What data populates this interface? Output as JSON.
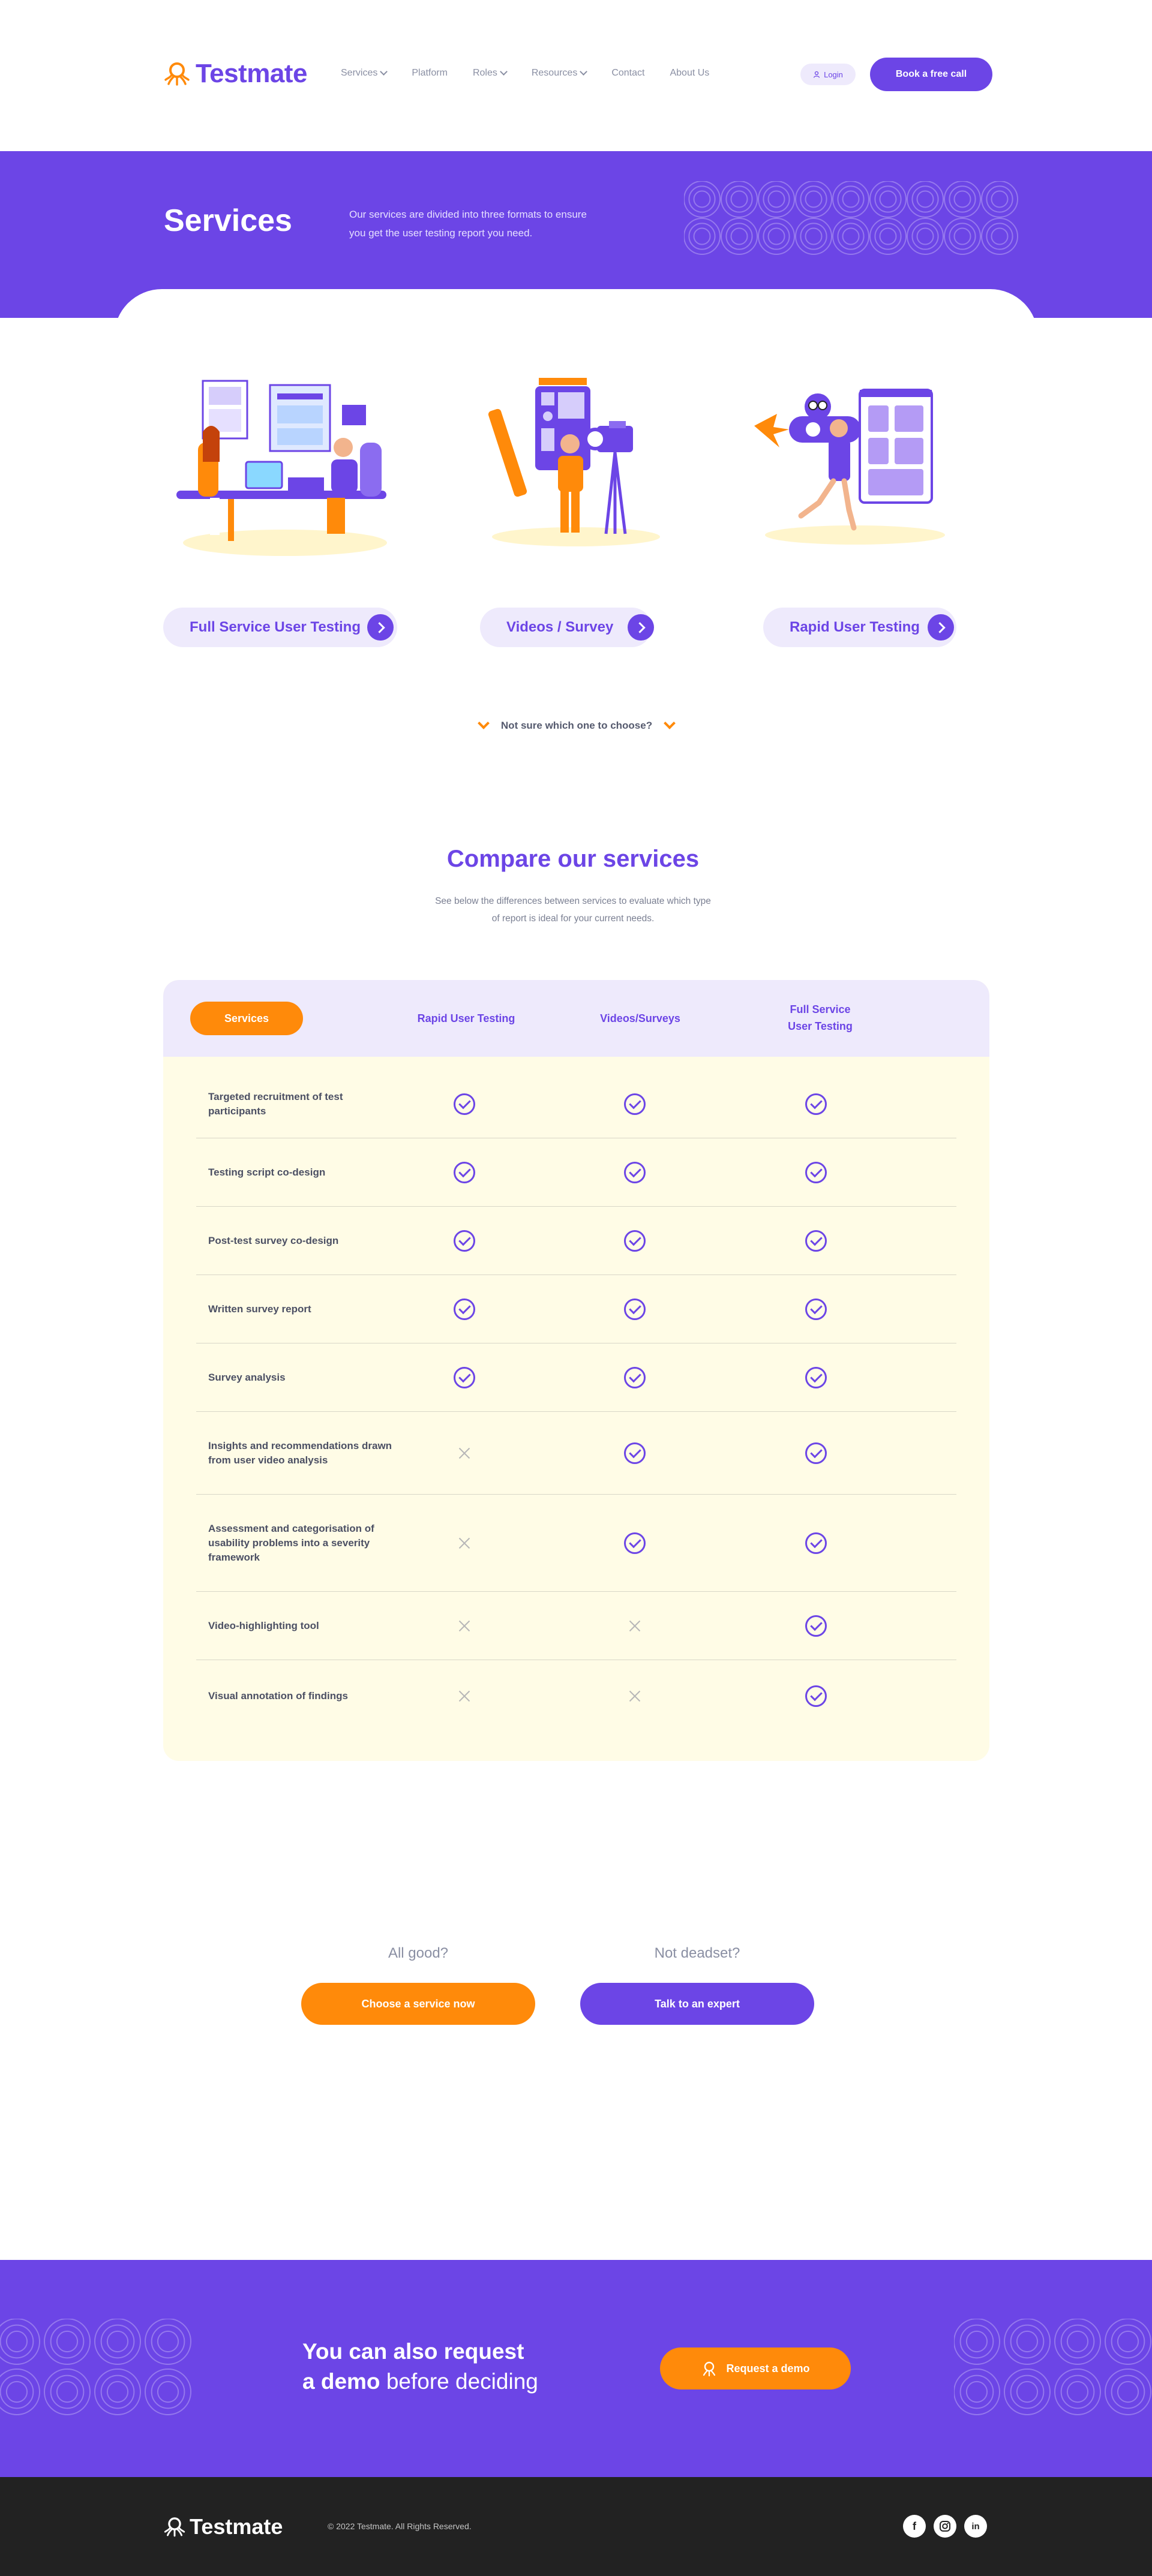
{
  "header": {
    "logo_text": "Testmate",
    "nav": [
      {
        "label": "Services",
        "dropdown": true
      },
      {
        "label": "Platform",
        "dropdown": false
      },
      {
        "label": "Roles",
        "dropdown": true
      },
      {
        "label": "Resources",
        "dropdown": true
      },
      {
        "label": "Contact",
        "dropdown": false
      },
      {
        "label": "About Us",
        "dropdown": false
      }
    ],
    "login_label": "Login",
    "cta_label": "Book a free call"
  },
  "hero": {
    "title": "Services",
    "description": "Our services are divided into three formats to ensure you get the user testing report you need."
  },
  "services": [
    {
      "label": "Full Service User Testing"
    },
    {
      "label": "Videos / Survey"
    },
    {
      "label": "Rapid User Testing"
    }
  ],
  "not_sure_label": "Not sure which one to choose?",
  "compare": {
    "title": "Compare our services",
    "subtitle": "See below the differences between services to evaluate which type of report is ideal for your current needs.",
    "columns": {
      "services": "Services",
      "rapid": "Rapid User Testing",
      "videos": "Videos/Surveys",
      "full_line1": "Full Service",
      "full_line2": "User Testing"
    },
    "rows": [
      {
        "label": "Targeted recruitment of test participants",
        "rapid": true,
        "videos": true,
        "full": true
      },
      {
        "label": "Testing script co-design",
        "rapid": true,
        "videos": true,
        "full": true
      },
      {
        "label": "Post-test survey co-design",
        "rapid": true,
        "videos": true,
        "full": true
      },
      {
        "label": "Written survey report",
        "rapid": true,
        "videos": true,
        "full": true
      },
      {
        "label": "Survey analysis",
        "rapid": true,
        "videos": true,
        "full": true
      },
      {
        "label": "Insights and recommendations drawn from user video analysis",
        "rapid": false,
        "videos": true,
        "full": true
      },
      {
        "label": "Assessment and categorisation of usability problems into a severity framework",
        "rapid": false,
        "videos": true,
        "full": true
      },
      {
        "label": "Video-highlighting tool",
        "rapid": false,
        "videos": false,
        "full": true
      },
      {
        "label": "Visual annotation of findings",
        "rapid": false,
        "videos": false,
        "full": true
      }
    ]
  },
  "cta": {
    "left_question": "All good?",
    "left_button": "Choose a service now",
    "right_question": "Not deadset?",
    "right_button": "Talk to an expert"
  },
  "demo": {
    "line1": "You can also request",
    "line2_bold": "a demo",
    "line2_rest": " before deciding",
    "button": "Request a demo"
  },
  "footer": {
    "logo_text": "Testmate",
    "copyright": "© 2022 Testmate. All Rights Reserved.",
    "social": [
      "facebook",
      "instagram",
      "linkedin"
    ]
  },
  "colors": {
    "brand_purple": "#6c45e6",
    "accent_orange": "#ff8a0a",
    "soft_lilac": "#eeeafc",
    "cream": "#fffce6",
    "footer_dark": "#222222"
  }
}
